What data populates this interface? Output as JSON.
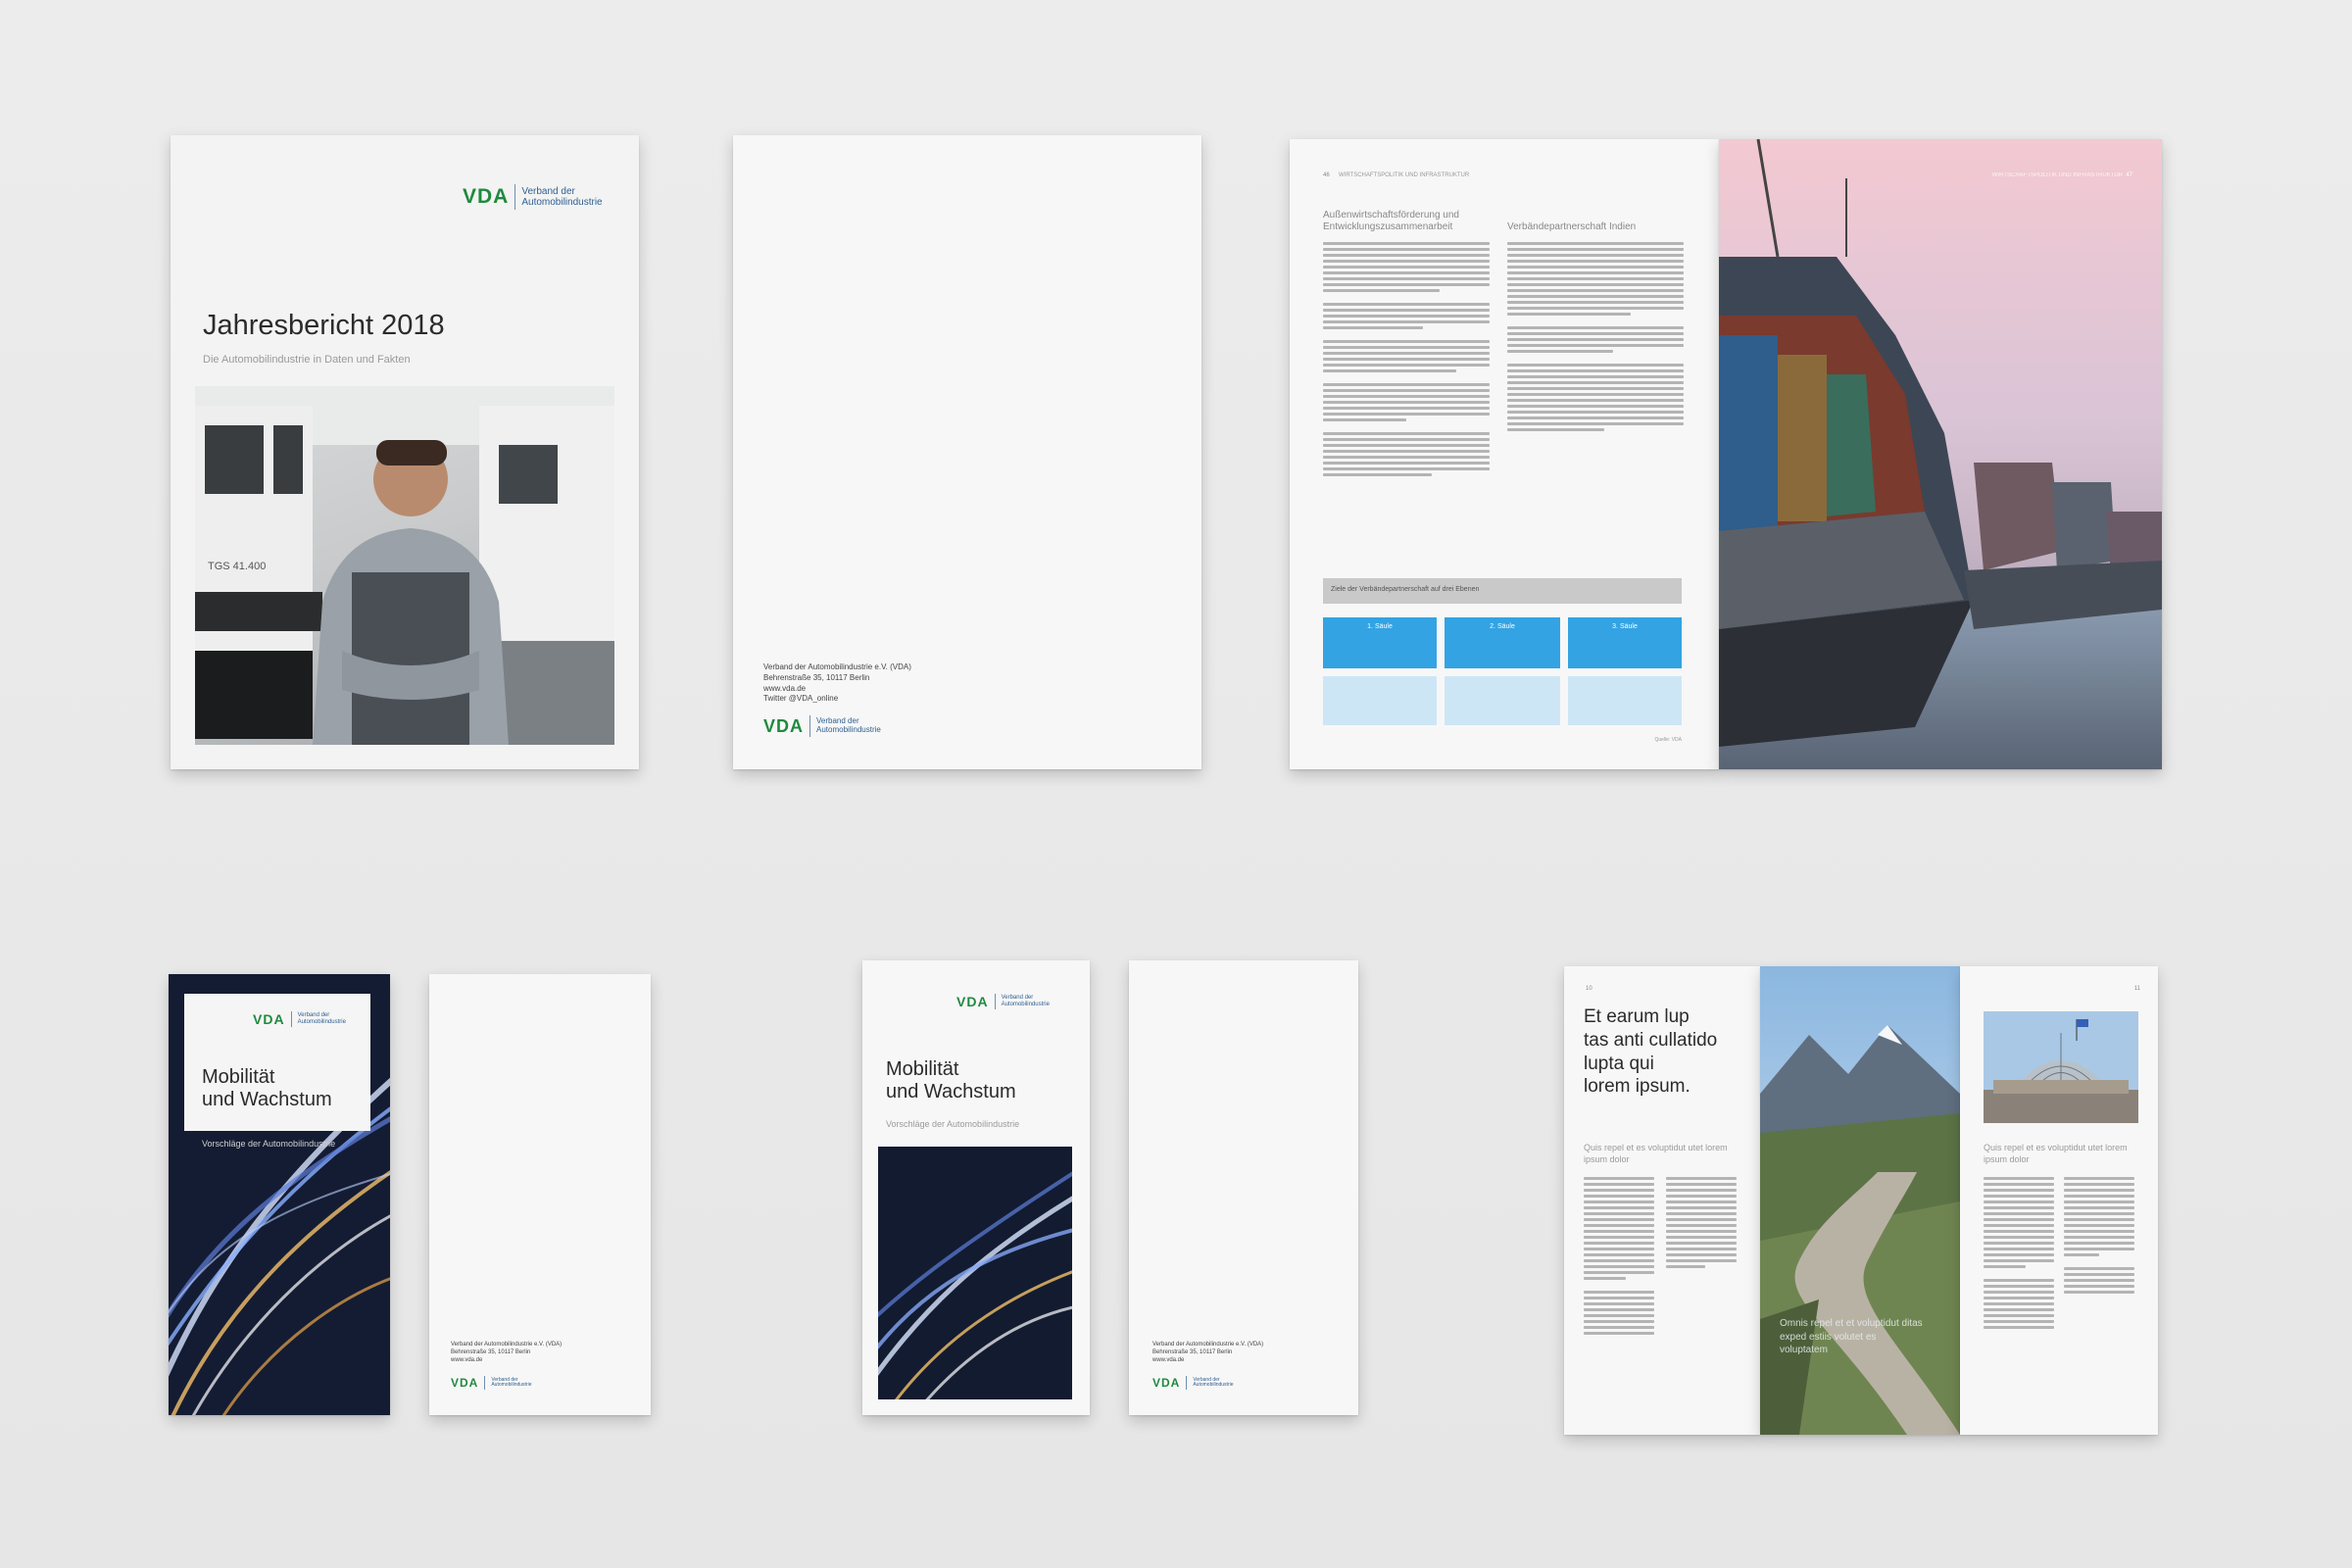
{
  "brand": {
    "logo_mark": "VDA",
    "logo_name_line1": "Verband der",
    "logo_name_line2": "Automobilindustrie",
    "colors": {
      "green": "#1f8a3f",
      "blue": "#2f5f91",
      "accent_blue": "#33a3e3"
    }
  },
  "annual_report": {
    "title": "Jahresbericht 2018",
    "subtitle": "Die Automobilindustrie in Daten und Fakten",
    "truck_label": "TGS 41.400"
  },
  "back_cover_report": {
    "address": [
      "Verband der Automobilindustrie e.V. (VDA)",
      "Behrenstraße 35, 10117 Berlin",
      "www.vda.de",
      "Twitter @VDA_online"
    ]
  },
  "spread": {
    "left_header": "WIRTSCHAFTSPOLITIK UND INFRASTRUKTUR",
    "right_header": "WIRTSCHAFTSPOLITIK UND INFRASTRUKTUR",
    "page_left": "46",
    "page_right": "47",
    "col1_heading": "Außenwirtschaftsförderung und Entwicklungszusammenarbeit",
    "col2_heading": "Verbändepartnerschaft Indien",
    "table_title": "Ziele der Verbändepartnerschaft auf drei Ebenen",
    "table_heads": [
      "1. Säule",
      "2. Säule",
      "3. Säule"
    ],
    "source": "Quelle: VDA"
  },
  "flyer_1": {
    "title_line1": "Mobilität",
    "title_line2": "und Wachstum",
    "subtitle": "Vorschläge der Automobilindustrie"
  },
  "flyer_1_back": {
    "address": [
      "Verband der Automobilindustrie e.V. (VDA)",
      "Behrenstraße 35, 10117 Berlin",
      "www.vda.de"
    ]
  },
  "flyer_2": {
    "title_line1": "Mobilität",
    "title_line2": "und Wachstum",
    "subtitle": "Vorschläge der Automobilindustrie"
  },
  "flyer_2_back": {
    "address": [
      "Verband der Automobilindustrie e.V. (VDA)",
      "Behrenstraße 35, 10117 Berlin",
      "www.vda.de"
    ]
  },
  "leporello": {
    "page_left": "10",
    "page_right": "11",
    "headline": [
      "Et earum lup",
      "tas anti cullatido",
      "lupta qui",
      "lorem ipsum."
    ],
    "intro_left": "Quis repel et es voluptidut utet lorem ipsum dolor",
    "intro_right": "Quis repel et es voluptidut utet lorem ipsum dolor",
    "overlay": "Omnis repel et et voluptidut ditas exped estiis volutet es voluptatem"
  }
}
